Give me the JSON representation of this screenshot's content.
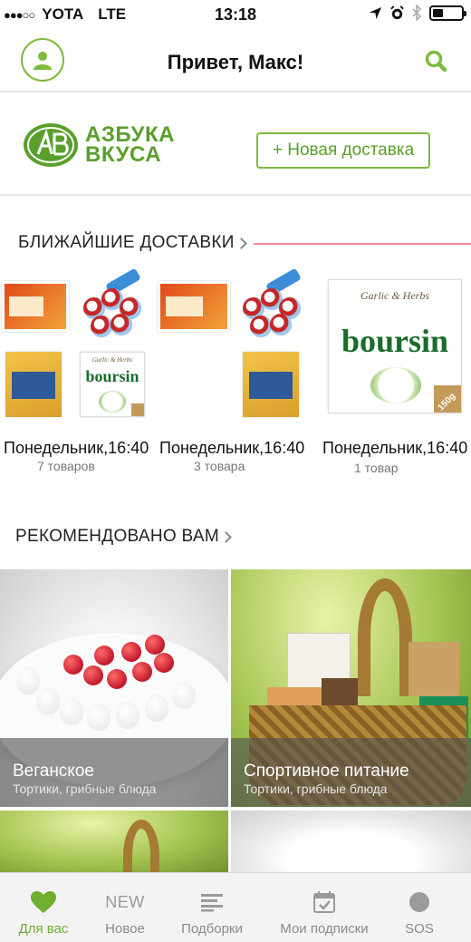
{
  "status_bar": {
    "signal": "●●●○○",
    "carrier": "YOTA",
    "network": "LTE",
    "time": "13:18",
    "battery_level": 0.35
  },
  "header": {
    "title": "Привет, Макс!"
  },
  "brand": {
    "logo_line1": "АЗБУКА",
    "logo_line2": "ВКУСА",
    "new_delivery_label": "+ Новая доставка",
    "accent_color": "#7dbb3c"
  },
  "upcoming": {
    "title": "БЛИЖАЙШИЕ ДОСТАВКИ",
    "deliveries": [
      {
        "date": "Понедельник,16:40",
        "count": "7 товаров"
      },
      {
        "date": "Понедельник,16:40",
        "count": "3 товара"
      },
      {
        "date": "Понедельник,16:40",
        "count": "1 товар"
      }
    ],
    "product_texts": {
      "boursin_small_top": "Garlic & Herbs",
      "boursin_small_name": "boursin",
      "boursin_large_top": "Garlic & Herbs",
      "boursin_large_name": "boursin",
      "boursin_weight": "150g"
    }
  },
  "recommended": {
    "title": "РЕКОМЕНДОВАНО ВАМ",
    "tiles": [
      {
        "title": "Веганское",
        "subtitle": "Тортики, грибные блюда"
      },
      {
        "title": "Спортивное питание",
        "subtitle": "Тортики, грибные блюда"
      }
    ]
  },
  "tabbar": {
    "tabs": [
      {
        "label": "Для вас",
        "icon": "heart-icon",
        "active": true
      },
      {
        "label": "Новое",
        "icon": "new-text-icon",
        "icon_text": "NEW"
      },
      {
        "label": "Подборки",
        "icon": "list-lines-icon"
      },
      {
        "label": "Мои подписки",
        "icon": "calendar-check-icon"
      },
      {
        "label": "SOS",
        "icon": "circle-icon"
      }
    ]
  }
}
